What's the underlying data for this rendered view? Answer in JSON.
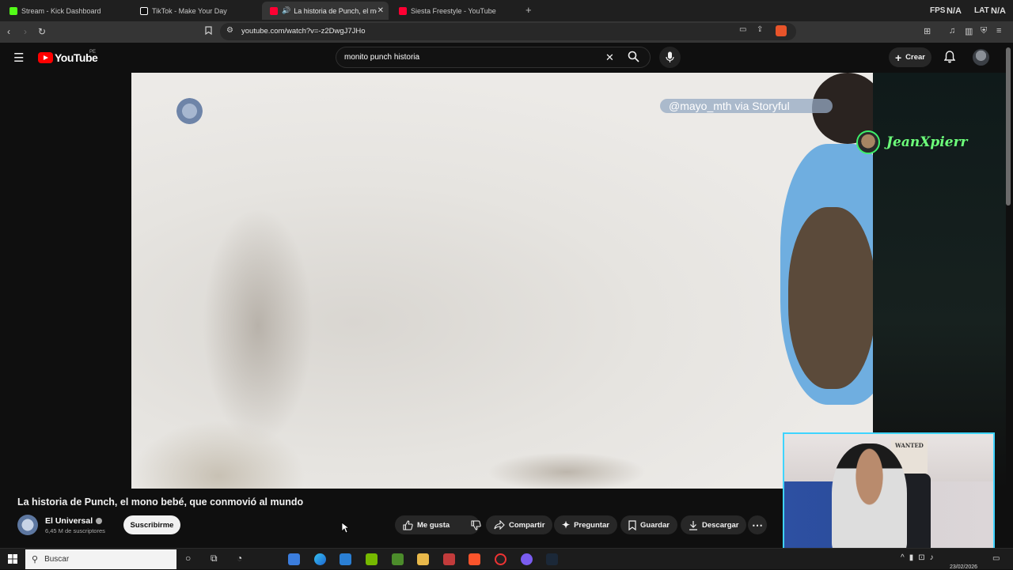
{
  "browser": {
    "tabs": [
      {
        "title": "Stream - Kick Dashboard",
        "favicon_color": "#53fc18"
      },
      {
        "title": "TikTok - Make Your Day",
        "favicon_color": "#111111"
      },
      {
        "title": "La historia de Punch, el mono",
        "favicon_color": "#ff0033",
        "active": true
      },
      {
        "title": "Siesta Freestyle - YouTube",
        "favicon_color": "#ff0033"
      }
    ],
    "hud": {
      "fps_label": "FPS",
      "fps_value": "N/A",
      "lat_label": "LAT",
      "lat_value": "N/A"
    },
    "url": "youtube.com/watch?v=-z2DwgJ7JHo"
  },
  "youtube": {
    "logo_text": "YouTube",
    "country_code": "PE",
    "search_query": "monito punch historia",
    "create_label": "Crear"
  },
  "video": {
    "credit_overlay": "@mayo_mth via Storyful",
    "streamer_overlay": "JeanXpierr",
    "webcam_poster_text": "WANTED",
    "title": "La historia de Punch, el mono bebé, que conmovió al mundo",
    "channel_name": "El Universal",
    "subscribers": "6,45 M de suscriptores",
    "subscribe_label": "Suscribirme",
    "actions": {
      "like": "Me gusta",
      "share": "Compartir",
      "ask": "Preguntar",
      "save": "Guardar",
      "download": "Descargar"
    }
  },
  "taskbar": {
    "search_placeholder": "Buscar",
    "date": "23/02/2026"
  },
  "colors": {
    "accent_red": "#ff0000",
    "overlay_green": "#6cff7a",
    "webcam_border": "#3fd4ff"
  }
}
